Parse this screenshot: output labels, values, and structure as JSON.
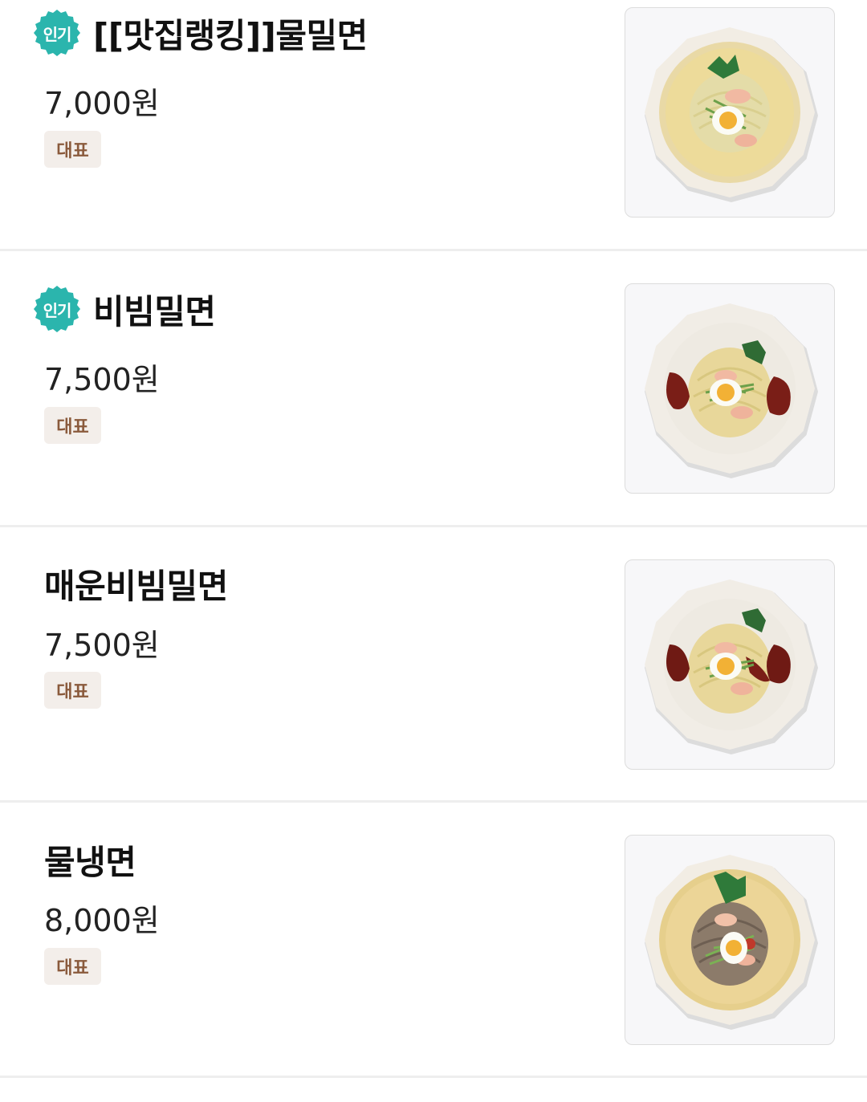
{
  "menu": {
    "items": [
      {
        "name": "[[맛집랭킹]]물밀면",
        "price": "7,000원",
        "tag": "대표",
        "badge": "인기",
        "image": "mul-milmyeon-photo"
      },
      {
        "name": "비빔밀면",
        "price": "7,500원",
        "tag": "대표",
        "badge": "인기",
        "image": "bibim-milmyeon-photo"
      },
      {
        "name": "매운비빔밀면",
        "price": "7,500원",
        "tag": "대표",
        "image": "spicy-bibim-milmyeon-photo"
      },
      {
        "name": "물냉면",
        "price": "8,000원",
        "tag": "대표",
        "image": "mul-naengmyeon-photo"
      }
    ]
  },
  "colors": {
    "badge": "#2bb5ad",
    "tag_bg": "#f3eeea",
    "tag_text": "#8a5a3c",
    "divider": "#eeeeee"
  }
}
